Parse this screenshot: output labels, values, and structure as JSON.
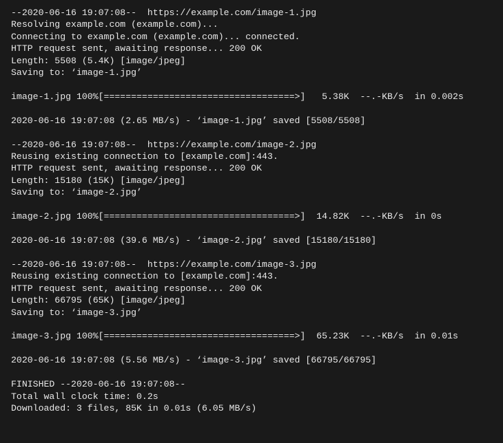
{
  "terminal": {
    "lines": [
      "--2020-06-16 19:07:08--  https://example.com/image-1.jpg",
      "Resolving example.com (example.com)...",
      "Connecting to example.com (example.com)... connected.",
      "HTTP request sent, awaiting response... 200 OK",
      "Length: 5508 (5.4K) [image/jpeg]",
      "Saving to: ‘image-1.jpg’",
      "",
      "image-1.jpg 100%[===================================>]   5.38K  --.-KB/s  in 0.002s",
      "",
      "2020-06-16 19:07:08 (2.65 MB/s) - ‘image-1.jpg’ saved [5508/5508]",
      "",
      "--2020-06-16 19:07:08--  https://example.com/image-2.jpg",
      "Reusing existing connection to [example.com]:443.",
      "HTTP request sent, awaiting response... 200 OK",
      "Length: 15180 (15K) [image/jpeg]",
      "Saving to: ‘image-2.jpg’",
      "",
      "image-2.jpg 100%[===================================>]  14.82K  --.-KB/s  in 0s",
      "",
      "2020-06-16 19:07:08 (39.6 MB/s) - ‘image-2.jpg’ saved [15180/15180]",
      "",
      "--2020-06-16 19:07:08--  https://example.com/image-3.jpg",
      "Reusing existing connection to [example.com]:443.",
      "HTTP request sent, awaiting response... 200 OK",
      "Length: 66795 (65K) [image/jpeg]",
      "Saving to: ‘image-3.jpg’",
      "",
      "image-3.jpg 100%[===================================>]  65.23K  --.-KB/s  in 0.01s",
      "",
      "2020-06-16 19:07:08 (5.56 MB/s) - ‘image-3.jpg’ saved [66795/66795]",
      "",
      "FINISHED --2020-06-16 19:07:08--",
      "Total wall clock time: 0.2s",
      "Downloaded: 3 files, 85K in 0.01s (6.05 MB/s)"
    ]
  }
}
